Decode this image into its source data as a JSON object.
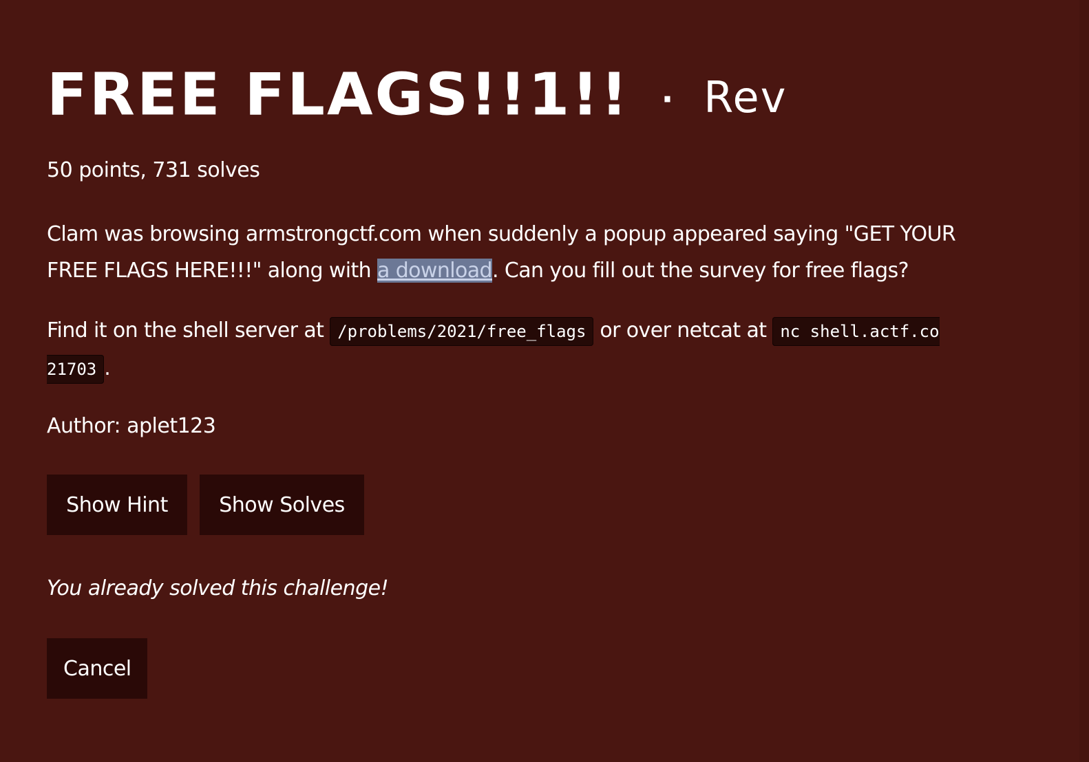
{
  "challenge": {
    "title": "FREE FLAGS!!1!!",
    "separator": "·",
    "category": "Rev",
    "meta": "50 points, 731 solves",
    "description": {
      "before_link": "Clam was browsing armstrongctf.com when suddenly a popup appeared saying \"GET YOUR FREE FLAGS HERE!!!\" along with ",
      "link_text": "a download",
      "after_link": ". Can you fill out the survey for free flags?"
    },
    "shell": {
      "prefix": "Find it on the shell server at ",
      "path": "/problems/2021/free_flags",
      "middle": " or over netcat at ",
      "netcat": "nc shell.actf.co 21703",
      "suffix": "."
    },
    "author": "Author: aplet123"
  },
  "buttons": {
    "hint_label": "Show Hint",
    "solves_label": "Show Solves",
    "cancel_label": "Cancel"
  },
  "status": {
    "solved_message": "You already solved this challenge!"
  }
}
